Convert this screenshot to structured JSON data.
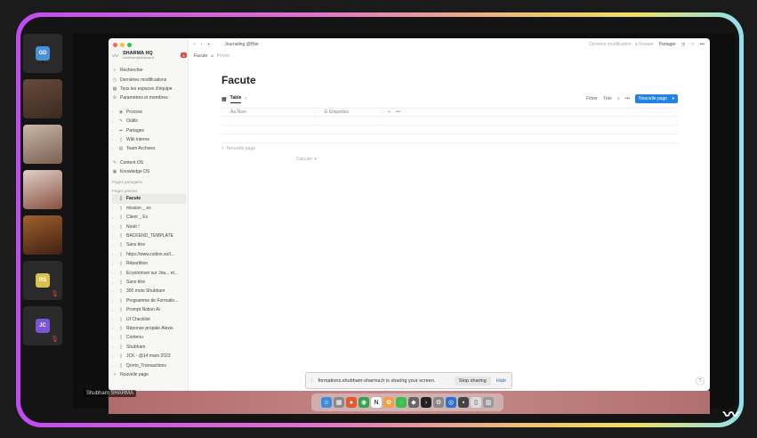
{
  "participants": [
    {
      "initials": "GD",
      "color": "#4a90d9",
      "photo": false,
      "muted": false
    },
    {
      "photo": true,
      "style": "photo",
      "muted": false
    },
    {
      "photo": true,
      "style": "photo2",
      "muted": false
    },
    {
      "photo": true,
      "style": "photo3",
      "muted": false
    },
    {
      "photo": true,
      "style": "photo4",
      "muted": false
    },
    {
      "initials": "RS",
      "color": "#d9c24a",
      "photo": false,
      "muted": true
    },
    {
      "initials": "JC",
      "color": "#7a55d9",
      "photo": false,
      "muted": true
    }
  ],
  "presenter_name": "Shubham SHARMA",
  "notion": {
    "tab_title": "Journaling @Hier",
    "workspace": {
      "name": "SHARMA HQ",
      "email": "shubham@sharma.fr",
      "badge": "5"
    },
    "breadcrumb": "Facute",
    "privacy": "Privée",
    "last_edit": "Dernière modification : à l'instant",
    "share_label": "Partager",
    "sidebar_top": [
      {
        "icon": "⌕",
        "label": "Rechercher"
      },
      {
        "icon": "◷",
        "label": "Dernières modifications"
      },
      {
        "icon": "▦",
        "label": "Tous les espaces d'équipe"
      },
      {
        "icon": "⚙",
        "label": "Paramètres et membres"
      }
    ],
    "sidebar_teams": [
      {
        "icon": "◉",
        "label": "Process"
      },
      {
        "icon": "✎",
        "label": "Outils"
      },
      {
        "icon": "➦",
        "label": "Partages"
      },
      {
        "icon": "▯",
        "label": "Wiki interne"
      },
      {
        "icon": "▤",
        "label": "Team Archives"
      }
    ],
    "sidebar_os": [
      {
        "icon": "✎",
        "label": "Content OS"
      },
      {
        "icon": "▣",
        "label": "Knowledge OS"
      }
    ],
    "shared_heading": "Pages partagées",
    "private_heading": "Pages privées",
    "private_pages": [
      {
        "label": "Facute",
        "active": true
      },
      {
        "label": "mission _ ex",
        "active": false
      },
      {
        "label": "Client _ Ex",
        "active": false
      },
      {
        "label": "Noob !",
        "active": false
      },
      {
        "label": "BACKEND_TEMPLATE",
        "active": false
      },
      {
        "label": "Sans titre",
        "active": false
      },
      {
        "label": "https://www.notion.so/l...",
        "active": false
      },
      {
        "label": "Répartition",
        "active": false
      },
      {
        "label": "Economiser sur Jira... et...",
        "active": false
      },
      {
        "label": "Sans titre",
        "active": false
      },
      {
        "label": "300 mots Shubham",
        "active": false
      },
      {
        "label": "Programme de Formatio...",
        "active": false
      },
      {
        "label": "Prompt Notion AI",
        "active": false
      },
      {
        "label": "UI Checklist",
        "active": false
      },
      {
        "label": "Réponse propale Alexis",
        "active": false
      },
      {
        "label": "Contenu",
        "active": false
      },
      {
        "label": "Shubham",
        "active": false
      },
      {
        "label": "JCK - @14 mars 2023",
        "active": false
      },
      {
        "label": "Qonto_Transactions",
        "active": false
      }
    ],
    "new_page": "Nouvelle page",
    "page_title": "Facute",
    "view_tab": "Table",
    "filter_label": "Filtrer",
    "sort_label": "Trier",
    "new_button": "Nouvelle page",
    "col_name": "Nom",
    "col_tags": "Étiquettes",
    "new_row": "Nouvelle page",
    "calc_label": "Calculer"
  },
  "share_bar": {
    "message": "formations.shubham-sharma.fr is sharing your screen.",
    "stop_label": "Stop sharing",
    "hide_label": "Hide"
  },
  "colors": {
    "accent": "#2383e2",
    "badge": "#e04848"
  }
}
